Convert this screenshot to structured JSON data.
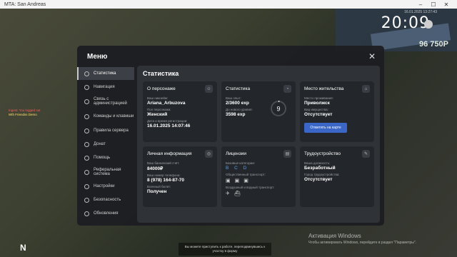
{
  "window": {
    "title": "MTA: San Andreas",
    "min": "–",
    "max": "☐",
    "close": "✕"
  },
  "hud": {
    "time": "20:09",
    "date": "16.01.2025 13:27:43",
    "money": "96 750P"
  },
  "chat": {
    "line1": "Ingest: You logged out",
    "line2": "Wth Friendss Demo"
  },
  "corner": "N",
  "watermark": {
    "title": "Активация Windows",
    "subtitle": "Чтобы активировать Windows, перейдите в раздел \"Параметры\"."
  },
  "notice": "Вы можете приступить к работе, переподвинувшись к участку в форму",
  "menu": {
    "title": "Меню",
    "sidebar": [
      {
        "label": "Статистика",
        "icon": "clock-icon",
        "active": true
      },
      {
        "label": "Навигация",
        "icon": "compass-icon"
      },
      {
        "label": "Связь с администрацией",
        "icon": "chat-icon"
      },
      {
        "label": "Команды и клавиши",
        "icon": "keyboard-icon"
      },
      {
        "label": "Правила сервера",
        "icon": "rules-icon"
      },
      {
        "label": "Донат",
        "icon": "donate-icon"
      },
      {
        "label": "Помощь",
        "icon": "help-icon"
      },
      {
        "label": "Реферальная система",
        "icon": "referral-icon"
      },
      {
        "label": "Настройки",
        "icon": "gear-icon"
      },
      {
        "label": "Безопасность",
        "icon": "shield-icon"
      },
      {
        "label": "Обновления",
        "icon": "refresh-icon"
      }
    ],
    "content_title": "Статистика",
    "about": {
      "title": "О персонаже",
      "nick_label": "Ваш никнейм:",
      "nick": "Ariana_Arbuzova",
      "gender_label": "Пол персонажа:",
      "gender": "Женский",
      "reg_label": "Дата и время регистрации:",
      "reg": "16.01.2025 14:07:46"
    },
    "stats": {
      "title": "Статистика",
      "exp_label": "Ваш опыт:",
      "exp": "2/3600 exp",
      "next_label": "До нового уровня:",
      "next": "3598 exp",
      "level": "9",
      "progress": 0.0006
    },
    "residence": {
      "title": "Место жительства",
      "place_label": "Место проживания:",
      "place": "Приволжск",
      "property_label": "Вид имущества:",
      "property": "Отсутствует",
      "button": "Отметить на карте"
    },
    "personal": {
      "title": "Личная информация",
      "bank_label": "Ваш банковский счёт:",
      "bank": "84000₽",
      "phone_label": "Ваш номер телефона:",
      "phone": "8 (978) 164-87-70",
      "military_label": "Военный билет:",
      "military": "Получен"
    },
    "licenses": {
      "title": "Лицензии",
      "basic_label": "Базовые категории:",
      "basic": "B C D",
      "public_label": "Общественный транспорт:",
      "air_label": "Воздушный и водный транспорт:"
    },
    "job": {
      "title": "Трудоустройство",
      "position_label": "Ваша должность:",
      "position": "Безработный",
      "city_label": "Город трудоустройства:",
      "city": "Отсутствует"
    }
  }
}
